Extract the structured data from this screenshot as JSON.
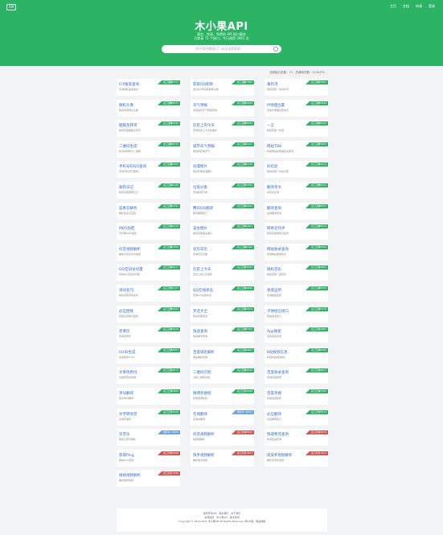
{
  "header": {
    "logo_text": "API",
    "nav": [
      "主页",
      "文档",
      "申请",
      "登录"
    ],
    "title": "木小果API",
    "subtitle_1": "稳定、快速、免费的 API 接口服务",
    "subtitle_2": "已收录 71 个接口，今日调用 3981 次"
  },
  "search": {
    "placeholder": "找不到所需接口？去试试搜索吧"
  },
  "stats": "当前接口总数：71 · 总调用次数：1125792",
  "colors": {
    "green": "#2bb463",
    "blue": "#6aa6e0",
    "red": "#d9534f"
  },
  "cards": [
    {
      "title": "ICP备案查询",
      "desc": "查询域名备案信息",
      "status": "接口正常",
      "count": "9084731",
      "color": "green"
    },
    {
      "title": "获取QQ昵称",
      "desc": "通过QQ号获取昵称头像",
      "status": "接口正常",
      "count": "4977985",
      "color": "green"
    },
    {
      "title": "毒鸡汤",
      "desc": "随机获取一条毒鸡汤",
      "status": "接口正常",
      "count": "2172981",
      "color": "green"
    },
    {
      "title": "随机头像",
      "desc": "随机获取男女头像",
      "status": "接口正常",
      "count": "1886675",
      "color": "green"
    },
    {
      "title": "天气预报",
      "desc": "全国城市天气预报查询",
      "status": "接口正常",
      "count": "1543208",
      "color": "green"
    },
    {
      "title": "IP地理位置",
      "desc": "查询IP地理位置信息",
      "status": "接口正常",
      "count": "1423498",
      "color": "green"
    },
    {
      "title": "脑筋急转弯",
      "desc": "随机获取脑筋急转弯",
      "status": "接口正常",
      "count": "1283590",
      "color": "green"
    },
    {
      "title": "历史上的今天",
      "desc": "查询历史上今天的事件",
      "status": "接口正常",
      "count": "1185662",
      "color": "green"
    },
    {
      "title": "一言",
      "desc": "随机获取一句话",
      "status": "接口正常",
      "count": "1045220",
      "color": "green"
    },
    {
      "title": "二维码生成",
      "desc": "将文本转换为二维码",
      "status": "接口正常",
      "count": "1038776",
      "color": "green"
    },
    {
      "title": "城市天气预报",
      "desc": "按城市查询天气",
      "status": "接口正常",
      "count": "952147",
      "color": "green"
    },
    {
      "title": "网站TDK",
      "desc": "获取网站标题描述关键词",
      "status": "接口正常",
      "count": "903855",
      "color": "green"
    },
    {
      "title": "手机号码QQ查询",
      "desc": "查询手机号归属地",
      "status": "接口正常",
      "count": "884701",
      "color": "green"
    },
    {
      "title": "动漫图片",
      "desc": "随机获取动漫图片",
      "status": "接口正常",
      "count": "861235",
      "color": "green"
    },
    {
      "title": "彩虹屁",
      "desc": "随机获取一句彩虹屁",
      "status": "接口正常",
      "count": "792214",
      "color": "green"
    },
    {
      "title": "舔狗日记",
      "desc": "随机获取舔狗日记",
      "status": "接口正常",
      "count": "751428",
      "color": "green"
    },
    {
      "title": "垃圾分类",
      "desc": "查询垃圾分类",
      "status": "接口正常",
      "count": "713350",
      "color": "green"
    },
    {
      "title": "翻译英文",
      "desc": "中英文互译",
      "status": "接口正常",
      "count": "689132",
      "color": "green"
    },
    {
      "title": "蓝奏云解析",
      "desc": "解析蓝奏云直链",
      "status": "接口正常",
      "count": "652781",
      "color": "green"
    },
    {
      "title": "腾讯QQ翻译",
      "desc": "腾讯翻译接口",
      "status": "接口正常",
      "count": "624019",
      "color": "green"
    },
    {
      "title": "翻译查询",
      "desc": "在线翻译查询",
      "status": "接口正常",
      "count": "598337",
      "color": "green"
    },
    {
      "title": "MD5加密",
      "desc": "字符串MD5加密",
      "status": "接口正常",
      "count": "541276",
      "color": "green"
    },
    {
      "title": "美女图片",
      "desc": "随机获取美女图片",
      "status": "接口正常",
      "count": "512907",
      "color": "green"
    },
    {
      "title": "网易云热评",
      "desc": "随机获取网易云热评",
      "status": "接口正常",
      "count": "498215",
      "color": "green"
    },
    {
      "title": "抖音视频解析",
      "desc": "解析抖音无水印视频",
      "status": "接口正常",
      "count": "467093",
      "color": "green"
    },
    {
      "title": "农历日历",
      "desc": "查询农历日期",
      "status": "接口正常",
      "count": "442186",
      "color": "green"
    },
    {
      "title": "网站收录查询",
      "desc": "查询网站收录情况",
      "status": "接口正常",
      "count": "421564",
      "color": "green"
    },
    {
      "title": "QQ空间访问量",
      "desc": "查询QQ空间访问量",
      "status": "接口正常",
      "count": "398417",
      "color": "green"
    },
    {
      "title": "历史上今天",
      "desc": "历史上的今天事件",
      "status": "接口正常",
      "count": "376592",
      "color": "green"
    },
    {
      "title": "随机音乐",
      "desc": "随机获取一首音乐",
      "status": "接口正常",
      "count": "352804",
      "color": "green"
    },
    {
      "title": "诗词名句",
      "desc": "随机获取诗词名句",
      "status": "接口正常",
      "count": "331257",
      "color": "green"
    },
    {
      "title": "QQ在线状态",
      "desc": "查询QQ在线状态",
      "status": "接口正常",
      "count": "309846",
      "color": "green"
    },
    {
      "title": "星座运势",
      "desc": "查询星座运势",
      "status": "接口正常",
      "count": "287633",
      "color": "green"
    },
    {
      "title": "必应壁纸",
      "desc": "获取必应每日壁纸",
      "status": "接口正常",
      "count": "265102",
      "color": "green"
    },
    {
      "title": "笑话大全",
      "desc": "随机获取笑话",
      "status": "接口正常",
      "count": "243579",
      "color": "green"
    },
    {
      "title": "子弹短信接口",
      "desc": "短信发送接口",
      "status": "接口正常",
      "count": "221478",
      "color": "green"
    },
    {
      "title": "老黄历",
      "desc": "查询老黄历",
      "status": "接口正常",
      "count": "203916",
      "color": "green"
    },
    {
      "title": "快递查询",
      "desc": "快递单号查询",
      "status": "接口正常",
      "count": "187254",
      "color": "green"
    },
    {
      "title": "App搜索",
      "desc": "应用商店搜索",
      "status": "接口正常",
      "count": "172893",
      "color": "green"
    },
    {
      "title": "UUID生成",
      "desc": "生成随机UUID",
      "status": "接口正常",
      "count": "158307",
      "color": "green"
    },
    {
      "title": "百度域名解析",
      "desc": "域名解析查询",
      "status": "接口正常",
      "count": "143662",
      "color": "green"
    },
    {
      "title": "B站视频信息",
      "desc": "获取B站视频信息",
      "status": "接口正常",
      "count": "131845",
      "color": "green"
    },
    {
      "title": "文章伪原创",
      "desc": "文章伪原创处理",
      "status": "接口正常",
      "count": "119274",
      "color": "green"
    },
    {
      "title": "二维码识别",
      "desc": "识别二维码内容",
      "status": "接口正常",
      "count": "106538",
      "color": "green"
    },
    {
      "title": "百度收录查询",
      "desc": "查询百度收录",
      "status": "接口正常",
      "count": "94217",
      "color": "green"
    },
    {
      "title": "单词翻译",
      "desc": "英文单词翻译",
      "status": "接口正常",
      "count": "83902",
      "color": "green"
    },
    {
      "title": "微博热搜榜",
      "desc": "获取微博热搜",
      "status": "接口正常",
      "count": "72648",
      "color": "green"
    },
    {
      "title": "百度热搜",
      "desc": "获取百度热搜",
      "status": "接口正常",
      "count": "63185",
      "color": "green"
    },
    {
      "title": "文字转语音",
      "desc": "文本转语音",
      "status": "接口正常",
      "count": "54326",
      "color": "green"
    },
    {
      "title": "在线翻译",
      "desc": "多语言翻译",
      "status": "维护中",
      "count": "46071",
      "color": "blue"
    },
    {
      "title": "必应翻译",
      "desc": "必应翻译接口",
      "status": "接口正常",
      "count": "38714",
      "color": "green"
    },
    {
      "title": "云音乐",
      "desc": "网易云音乐解析",
      "status": "维护中",
      "count": "31952",
      "color": "blue"
    },
    {
      "title": "抖音视频解析",
      "desc": "短视频解析",
      "status": "接口异常",
      "count": "25813",
      "color": "red"
    },
    {
      "title": "快递物流查询",
      "desc": "物流轨迹查询",
      "status": "接口异常",
      "count": "19476",
      "color": "red"
    },
    {
      "title": "获取Ping",
      "desc": "网站Ping测试",
      "status": "接口异常",
      "count": "14208",
      "color": "red"
    },
    {
      "title": "快手视频解析",
      "desc": "解析快手视频",
      "status": "接口异常",
      "count": "9637",
      "color": "red"
    },
    {
      "title": "皮皮虾视频解析",
      "desc": "解析皮皮虾视频",
      "status": "接口异常",
      "count": "5421",
      "color": "red"
    },
    {
      "title": "微视视频解析",
      "desc": "解析微视视频",
      "status": "接口异常",
      "count": "2398",
      "color": "red"
    }
  ],
  "footer": {
    "line1": "免费申请API · 联系我们 · 关于我们",
    "line2": "友情链接 · 木小果API · 技术支持",
    "line3": "Copyright © 2019-2021 木小果API All Rights Reserved. 鄂ICP备 · 网站地图"
  }
}
